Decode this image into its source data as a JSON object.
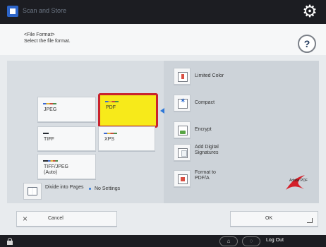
{
  "app": {
    "title_text": "Scan and Store",
    "settings_icon": "gear-icon"
  },
  "header": {
    "title_line_1": "<File Format>",
    "title_line_2": "Select the file format.",
    "help_label": "?"
  },
  "formats": [
    {
      "label": "JPEG",
      "selected": false
    },
    {
      "label": "PDF",
      "selected": true
    },
    {
      "label": "TIFF",
      "selected": false
    },
    {
      "label": "XPS",
      "selected": false
    },
    {
      "label": "TIFF/JPEG (Auto)",
      "selected": false
    }
  ],
  "divide": {
    "label": "Divide into Pages",
    "setting": "No Settings"
  },
  "options": [
    {
      "label": "Limited Color"
    },
    {
      "label": "Compact"
    },
    {
      "label": "Encrypt"
    },
    {
      "label": "Add Digital Signatures"
    },
    {
      "label": "Format to PDF/A"
    }
  ],
  "buttons": {
    "cancel_label": "Cancel",
    "ok_label": "OK",
    "cancel_icon": "close-icon"
  },
  "status": {
    "logout_label": "Log Out"
  },
  "colors": {
    "selected_fill": "#f7ea1a",
    "selected_border": "#c9232d",
    "accent": "#2d78d8",
    "topbar": "#1c1d22"
  }
}
